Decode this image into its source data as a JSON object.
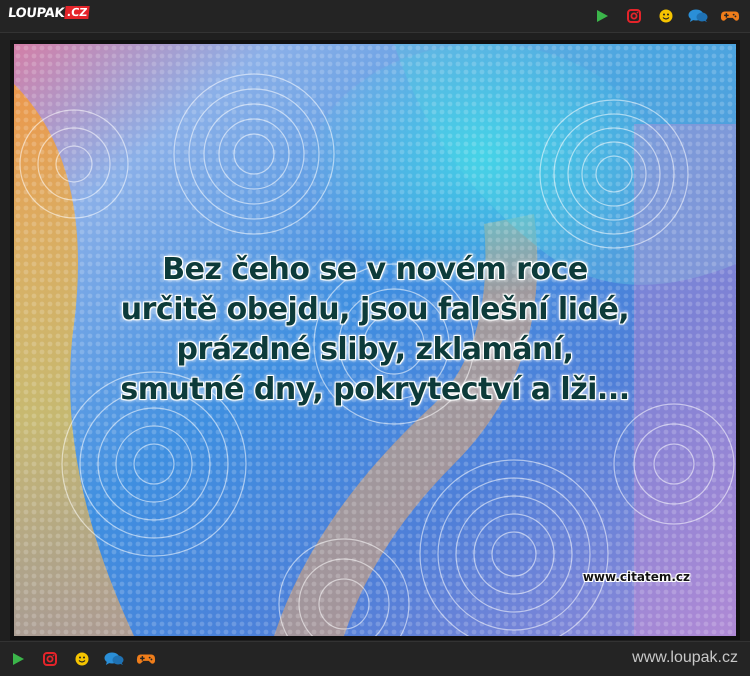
{
  "header": {
    "logo": {
      "main": "LOUPAK",
      "tld": ".CZ"
    },
    "icons": [
      {
        "name": "play-icon",
        "color": "#3bb54a"
      },
      {
        "name": "instagram-icon",
        "color": "#e4242a"
      },
      {
        "name": "smiley-icon",
        "color": "#f5c400"
      },
      {
        "name": "chat-icon",
        "color": "#2a8fd8"
      },
      {
        "name": "gamepad-icon",
        "color": "#f07d1a"
      }
    ]
  },
  "image": {
    "quote_lines": [
      "Bez čeho se v novém roce",
      "určitě obejdu, jsou falešní lidé,",
      "prázdné sliby, zklamání,",
      "smutné dny, pokrytectví a lži..."
    ],
    "watermark": "www.citatem.cz"
  },
  "footer": {
    "site_url": "www.loupak.cz"
  }
}
